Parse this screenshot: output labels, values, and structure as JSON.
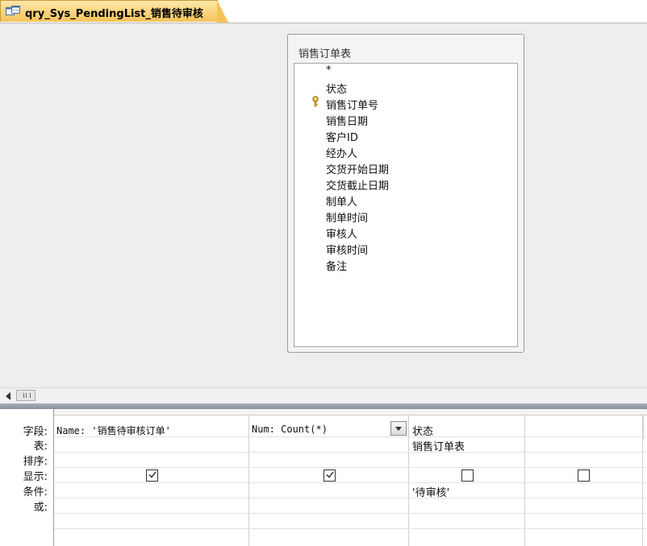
{
  "tab": {
    "title": "qry_Sys_PendingList_销售待审核",
    "icon": "query-icon"
  },
  "table_box": {
    "title": "销售订单表",
    "fields": [
      "*",
      "状态",
      "销售订单号",
      "销售日期",
      "客户ID",
      "经办人",
      "交货开始日期",
      "交货截止日期",
      "制单人",
      "制单时间",
      "审核人",
      "审核时间",
      "备注"
    ],
    "primary_key_field": "销售订单号"
  },
  "grid": {
    "row_labels": [
      "字段:",
      "表:",
      "排序:",
      "显示:",
      "条件:",
      "或:"
    ],
    "columns": [
      {
        "field": "Name: '销售待审核订单'",
        "table": "",
        "show": true,
        "criteria": ""
      },
      {
        "field": "Num: Count(*)",
        "table": "",
        "show": true,
        "criteria": ""
      },
      {
        "field": "状态",
        "table": "销售订单表",
        "show": false,
        "criteria": "'待审核'"
      },
      {
        "field": "",
        "table": "",
        "show": false,
        "criteria": ""
      }
    ]
  },
  "colors": {
    "tab_active": "#f6c35a",
    "splitter": "#8b919b"
  }
}
